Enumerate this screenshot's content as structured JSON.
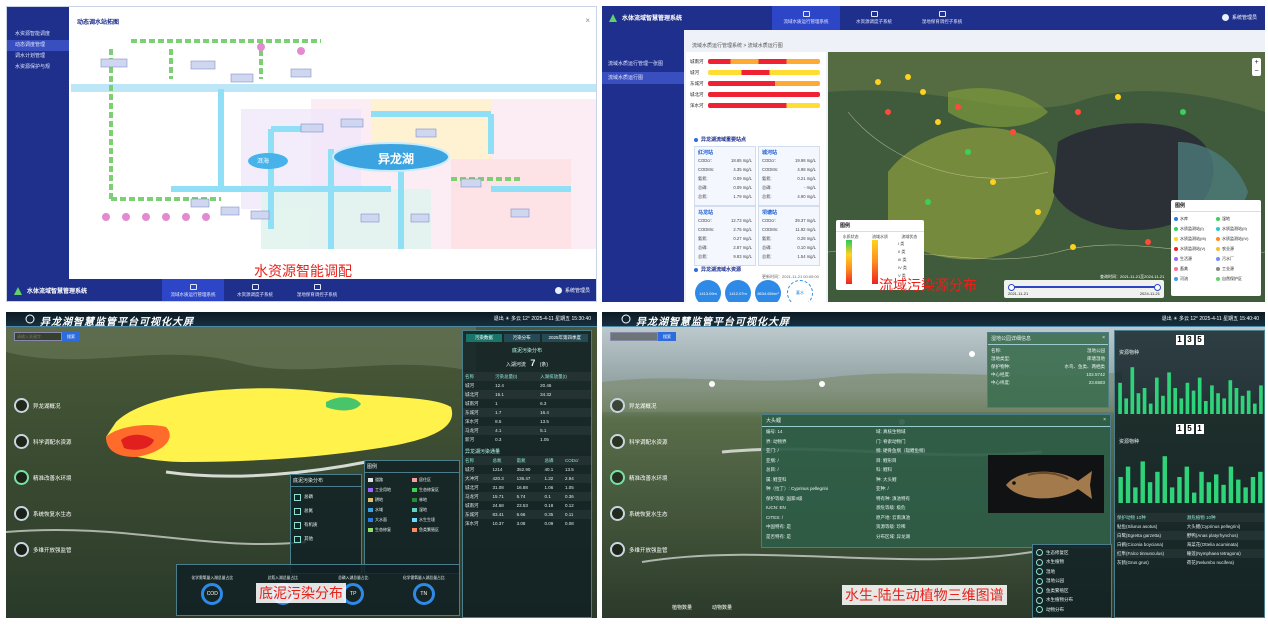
{
  "panel1": {
    "sidebar": [
      "水资源智能调度",
      "动态调度管理",
      "调水计划管理",
      "水资源保护与规"
    ],
    "main_title": "动态调水站拓图",
    "lake_small": "洱海",
    "lake_big": "异龙湖",
    "caption": "水资源智能调配",
    "bottom_bar": {
      "title": "水体流域智慧管理系统",
      "nav": [
        "流域水质运行管理系统",
        "水资源调度子系统",
        "湿地保育调控子系统"
      ],
      "user": "系统管理员"
    }
  },
  "panel2": {
    "top_bar": {
      "title": "水体流域智慧管理系统",
      "nav": [
        "流域水质运行管理系统",
        "水资源调度子系统",
        "湿地保育调控子系统"
      ],
      "user": "系统管理员"
    },
    "sidebar": [
      "流域水质运行管理一张图",
      "流域水质运行图"
    ],
    "breadcrumb": "流域水质运行管理系统  >  流域水质运行图",
    "rows": [
      "城南河",
      "城河",
      "东城河",
      "城北河",
      "浑水河"
    ],
    "sec_monitor": "异龙湖流域重要站点",
    "stations": [
      {
        "name": "红河站",
        "rows": [
          [
            "CODcr:",
            "18.65 mg/L"
          ],
          [
            "CODMn:",
            "4.35 mg/L"
          ],
          [
            "氨氮:",
            "0.09 mg/L"
          ],
          [
            "总磷:",
            "0.09 mg/L"
          ],
          [
            "总氮:",
            "1.79 mg/L"
          ]
        ]
      },
      {
        "name": "城河站",
        "rows": [
          [
            "CODcr:",
            "19.98 mg/L"
          ],
          [
            "CODMn:",
            "4.98 mg/L"
          ],
          [
            "氨氮:",
            "0.21 mg/L"
          ],
          [
            "总磷:",
            "- mg/L"
          ],
          [
            "总氮:",
            "4.90 mg/L"
          ]
        ]
      },
      {
        "name": "马龙站",
        "rows": [
          [
            "CODcr:",
            "12.73 mg/L"
          ],
          [
            "CODMn:",
            "2.75 mg/L"
          ],
          [
            "氨氮:",
            "0.27 mg/L"
          ],
          [
            "总磷:",
            "2.87 mg/L"
          ],
          [
            "总氮:",
            "9.83 mg/L"
          ]
        ]
      },
      {
        "name": "坝塘站",
        "rows": [
          [
            "CODcr:",
            "39.37 mg/L"
          ],
          [
            "CODMn:",
            "11.92 mg/L"
          ],
          [
            "氨氮:",
            "0.28 mg/L"
          ],
          [
            "总磷:",
            "0.10 mg/L"
          ],
          [
            "总氮:",
            "1.54 mg/L"
          ]
        ]
      }
    ],
    "sec_water": "异龙湖流域水资源",
    "update_time": "更新时间：2021-11-21 00:00:00",
    "stats": [
      "1413.09m",
      "1412.07m",
      "8634.65t/m³",
      "蓄水"
    ],
    "legend_left": {
      "title": "图例",
      "cols": [
        "水质状态",
        "流域水质",
        "流域状态"
      ],
      "items": [
        "I 类",
        "II 类",
        "III 类",
        "IV 类",
        "V 类"
      ]
    },
    "legend_right": {
      "title": "图例",
      "items": [
        "水库",
        "湿地",
        "水质监测站(I)",
        "水质监测站(II)",
        "水质监测站(III)",
        "水质监测站(IV)",
        "水质监测站(V)",
        "农业源",
        "生活源",
        "污水厂",
        "畜禽",
        "工业源",
        "河流",
        "自然保护区"
      ]
    },
    "timeline": {
      "start": "2021-11-21",
      "end": "2024-11-21",
      "left": "2021",
      "query": "查询时间：2021-11-21至2024-11-21"
    },
    "caption": "流域污染源分布"
  },
  "panel3": {
    "title": "异龙湖智慧监管平台可视化大屏",
    "header_right": "退出  ☀ 多云 12°  2025-4-11 星期五 15:30:40",
    "search_placeholder": "请输入关键字",
    "search_btn": "搜索",
    "menu": [
      "异龙湖概况",
      "科学调配水资源",
      "精准改善水环境",
      "系统恢复水生态",
      "多维开放强监管"
    ],
    "tabs": [
      "污染数据",
      "污染分布",
      "2025年第四季度"
    ],
    "table_title": "底泥污染分布",
    "count_label": "入湖河流",
    "count_value": "7",
    "count_unit": "(条)",
    "table_headers": [
      "名称",
      "污染总量(t)",
      "入湖排放量(t)"
    ],
    "table_rows": [
      [
        "城河",
        "12.4",
        "20.46"
      ],
      [
        "城北河",
        "16.1",
        "34.32"
      ],
      [
        "城南河",
        "1",
        "6.3"
      ],
      [
        "东城河",
        "1.7",
        "16.4"
      ],
      [
        "浑水河",
        "8.5",
        "13.5"
      ],
      [
        "马龙河",
        "4.1",
        "5.1"
      ],
      [
        "新河",
        "0.3",
        "1.05"
      ]
    ],
    "table2_title": "异龙湖污染通量",
    "table2_headers": [
      "名称",
      "总氮",
      "氨氮",
      "总磷",
      "CODcr"
    ],
    "table2_rows": [
      [
        "城河",
        "1214",
        "352.90",
        "40.1",
        "13.5"
      ],
      [
        "大冲河",
        "420.3",
        "136.47",
        "1.32",
        "2.94"
      ],
      [
        "城北河",
        "31.08",
        "16.88",
        "1.06",
        "1.05"
      ],
      [
        "马龙河",
        "15.71",
        "5.74",
        "0.1",
        "0.36"
      ],
      [
        "城南河",
        "24.68",
        "23.53",
        "0.18",
        "0.12"
      ],
      [
        "东城河",
        "83.41",
        "6.66",
        "0.35",
        "0.11"
      ],
      [
        "浑水河",
        "10.37",
        "3.08",
        "0.09",
        "0.08"
      ]
    ],
    "legend_title": "图例",
    "legend_items": [
      "道路",
      "居住区",
      "工业用地",
      "生态修复区",
      "耕地",
      "林地",
      "水域",
      "湿地",
      "大水面",
      "水生生境",
      "生态修复",
      "鱼类繁殖区"
    ],
    "sub_title": "底泥污染分布",
    "sub_items": [
      "总磷",
      "总氮",
      "有机质",
      "其他"
    ],
    "gauges": [
      "COD",
      "TN",
      "TP",
      "TN"
    ],
    "gauge_labels": [
      "化学需氧量入湖总量占比",
      "总氮入湖总量占比",
      "总磷入湖总量占比",
      "化学需氧量入湖总量占比"
    ],
    "caption": "底泥污染分布"
  },
  "panel4": {
    "title": "异龙湖智慧监管平台可视化大屏",
    "header_right": "退出  ☀ 多云 12°  2025-4-11 星期五 15:40:40",
    "search_placeholder": "请输入关键字",
    "search_btn": "搜索",
    "menu": [
      "异龙湖概况",
      "科学调配水资源",
      "精准改善水环境",
      "系统恢复水生态",
      "多维开放强监管"
    ],
    "popup_small": {
      "title": "湿地公园详细信息",
      "rows": [
        [
          "名称:",
          "湿地公园"
        ],
        [
          "湿地类型:",
          "库塘湿地"
        ],
        [
          "保护物种:",
          "水鸟、鱼类、两栖类"
        ],
        [
          "中心经度:",
          "102.5742"
        ],
        [
          "中心纬度:",
          "23.6583"
        ]
      ]
    },
    "popup_fish": {
      "title": "大头鲤",
      "rows": [
        [
          "编号: 14",
          "域: 真核生物域"
        ],
        [
          "界: 动物界",
          "门: 脊索动物门"
        ],
        [
          "亚门: /",
          "纲: 硬骨鱼纲（辐鳍鱼纲）"
        ],
        [
          "亚纲: /",
          "目: 鲤形目"
        ],
        [
          "总目: /",
          "科: 鲤科"
        ],
        [
          "属: 鲤亚科",
          "种: 大头鲤"
        ],
        [
          "种（拉丁）: Cyprinus pellegrini",
          "亚种: /"
        ],
        [
          "保护等级: 国家II级",
          "特有种: 滇池特有"
        ],
        [
          "IUCN: EN",
          "濒危等级: 极危"
        ],
        [
          "CITES: /",
          "原产地: 云南滇池"
        ],
        [
          "中国特有: 是",
          "资源等级: 珍稀"
        ],
        [
          "是否特有: 是",
          "分布区域: 异龙湖"
        ]
      ]
    },
    "res_title1": "资源物种",
    "res_count1": [
      "1",
      "3",
      "5"
    ],
    "res_title2": "资源物种",
    "res_count2": [
      "1",
      "5",
      "1"
    ],
    "bar1": [
      0.6,
      0.3,
      0.9,
      0.4,
      0.5,
      0.2,
      0.7,
      0.35,
      0.8,
      0.5,
      0.3,
      0.6,
      0.45,
      0.7,
      0.25,
      0.55,
      0.4,
      0.3,
      0.65,
      0.5,
      0.35,
      0.45,
      0.2,
      0.55
    ],
    "bar2": [
      0.5,
      0.7,
      0.3,
      0.8,
      0.4,
      0.6,
      0.9,
      0.3,
      0.5,
      0.7,
      0.2,
      0.6,
      0.4,
      0.55,
      0.35,
      0.7,
      0.45,
      0.3,
      0.5,
      0.6
    ],
    "bottom_table": [
      [
        "保护动物 10种",
        "濒危植物 10种"
      ],
      [
        "鲇鱼(Silurus asotus)",
        "大头鲤(Cyprinus pellegrini)"
      ],
      [
        "白鹭(Egretta garzetta)",
        "野鸭(Anas platyrhynchos)"
      ],
      [
        "白鹳(Ciconia boyciana)",
        "海菜花(Ottelia acuminata)"
      ],
      [
        "红隼(Falco tinnunculus)",
        "睡莲(Nymphaea tetragona)"
      ],
      [
        "灰鹤(Grus grus)",
        "荷花(Nelumbo nucifera)"
      ]
    ],
    "list": [
      "生态修复区",
      "水生植物",
      "湿地",
      "湿地公园",
      "鱼类繁殖区",
      "水生植物分布",
      "动物分布"
    ],
    "bottom_tabs": [
      "植物数量",
      "动物数量"
    ],
    "caption": "水生-陆生动植物三维图谱"
  }
}
